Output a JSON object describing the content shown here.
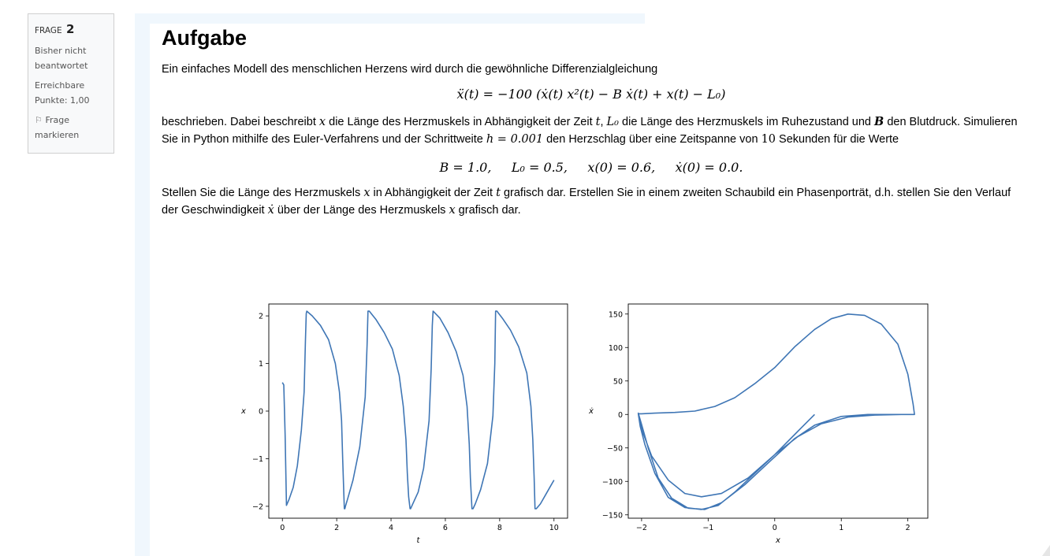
{
  "info": {
    "frage_label": "FRAGE",
    "frage_number": "2",
    "status": "Bisher nicht beantwortet",
    "points_label": "Erreichbare Punkte: 1,00",
    "flag_label": "Frage markieren"
  },
  "task": {
    "title": "Aufgabe",
    "intro": "Ein einfaches Modell des menschlichen Herzens wird durch die gewöhnliche Differenzialgleichung",
    "equation": "ẍ(t) = −100 (ẋ(t) x²(t) − B ẋ(t) + x(t) − L₀)",
    "desc_1": "beschrieben. Dabei beschreibt",
    "var_x": "x",
    "desc_2": "die Länge des Herzmuskels in Abhängigkeit der Zeit",
    "var_t": "t",
    "comma": ",",
    "var_L0": "L₀",
    "desc_3": "die Länge des Herzmuskels im Ruhezustand und",
    "var_B": "B",
    "desc_4": "den Blutdruck. Simulieren Sie in Python mithilfe des Euler-Verfahrens und der Schrittweite",
    "step": "h = 0.001",
    "desc_5": "den Herzschlag über eine Zeitspanne von",
    "duration": "10",
    "desc_6": "Sekunden für die Werte",
    "params": "B = 1.0,     L₀ = 0.5,     x(0) = 0.6,     ẋ(0) = 0.0.",
    "ask_1": "Stellen Sie die Länge des Herzmuskels",
    "ask_2": "in Abhängigkeit der Zeit",
    "ask_3": "grafisch dar. Erstellen Sie in einem zweiten Schaubild ein Phasenporträt, d.h. stellen Sie den Verlauf der Geschwindigkeit",
    "var_xdot": "ẋ",
    "ask_4": "über der Länge des Herzmuskels",
    "ask_5": "grafisch dar."
  },
  "colors": {
    "line": "#3f76b5",
    "panel": "#f0f7fd"
  },
  "chart_data": [
    {
      "type": "line",
      "xlabel": "t",
      "ylabel": "x",
      "xlim": [
        -0.5,
        10.5
      ],
      "ylim": [
        -2.25,
        2.25
      ],
      "xticks": [
        "0",
        "2",
        "4",
        "6",
        "8",
        "10"
      ],
      "yticks": [
        "−2",
        "−1",
        "0",
        "1",
        "2"
      ],
      "series": [
        {
          "x": [
            0,
            0.05,
            0.1,
            0.15,
            0.25,
            0.4,
            0.55,
            0.7,
            0.8,
            0.85,
            0.88,
            0.9,
            1.1,
            1.4,
            1.7,
            1.95,
            2.1,
            2.18,
            2.22,
            2.26,
            2.28,
            2.3,
            2.32,
            2.4,
            2.6,
            2.85,
            3.05,
            3.12,
            3.15,
            3.2,
            3.45,
            3.75,
            4.05,
            4.3,
            4.45,
            4.55,
            4.6,
            4.65,
            4.7,
            4.72,
            4.8,
            5.0,
            5.2,
            5.4,
            5.48,
            5.52,
            5.55,
            5.8,
            6.1,
            6.4,
            6.65,
            6.8,
            6.88,
            6.92,
            6.98,
            7.02,
            7.1,
            7.3,
            7.55,
            7.75,
            7.82,
            7.85,
            7.9,
            8.1,
            8.4,
            8.7,
            9.0,
            9.15,
            9.22,
            9.27,
            9.3,
            9.35,
            9.5,
            9.7,
            9.9,
            10.0
          ],
          "y": [
            0.6,
            0.55,
            -0.5,
            -1.98,
            -1.85,
            -1.6,
            -1.15,
            -0.4,
            0.4,
            1.5,
            2.05,
            2.1,
            2.0,
            1.8,
            1.5,
            1.0,
            0.4,
            -0.2,
            -1.0,
            -1.7,
            -2.05,
            -2.05,
            -2.0,
            -1.85,
            -1.45,
            -0.75,
            0.3,
            1.4,
            2.1,
            2.1,
            1.92,
            1.65,
            1.3,
            0.75,
            0.1,
            -0.6,
            -1.3,
            -1.8,
            -2.05,
            -2.05,
            -1.95,
            -1.7,
            -1.2,
            -0.2,
            0.9,
            1.8,
            2.1,
            1.95,
            1.65,
            1.25,
            0.75,
            0.1,
            -0.7,
            -1.4,
            -2.05,
            -2.05,
            -1.95,
            -1.65,
            -1.1,
            -0.1,
            1.0,
            2.1,
            2.1,
            1.95,
            1.7,
            1.35,
            0.8,
            0.1,
            -0.6,
            -1.4,
            -2.05,
            -2.05,
            -1.95,
            -1.75,
            -1.55,
            -1.45
          ]
        }
      ]
    },
    {
      "type": "line",
      "xlabel": "x",
      "ylabel": "ẋ",
      "xlim": [
        -2.2,
        2.3
      ],
      "ylim": [
        -155,
        165
      ],
      "xticks": [
        "−2",
        "−1",
        "0",
        "1",
        "2"
      ],
      "yticks": [
        "−150",
        "−100",
        "−50",
        "0",
        "50",
        "100",
        "150"
      ],
      "series": [
        {
          "x": [
            0.6,
            0.35,
            0.0,
            -0.4,
            -0.8,
            -1.1,
            -1.35,
            -1.6,
            -1.85,
            -2.0,
            -2.05,
            -2.0,
            -1.9,
            -1.75,
            -1.55,
            -1.3,
            -1.05,
            -0.8,
            -0.45,
            -0.05,
            0.3,
            0.6,
            1.0,
            1.4,
            1.8,
            2.05,
            2.1,
            2.08,
            2.0,
            1.85,
            1.6,
            1.35,
            1.1,
            0.85,
            0.6,
            0.3,
            0.0,
            -0.3,
            -0.6,
            -0.9,
            -1.2,
            -1.5,
            -1.8,
            -2.0,
            -2.05,
            -2.02,
            -1.95,
            -1.8,
            -1.6,
            -1.35,
            -1.1,
            -0.85,
            -0.6,
            -0.3,
            0.0,
            0.35,
            0.7,
            1.1,
            1.5,
            1.9,
            2.1
          ],
          "y": [
            0,
            -25,
            -60,
            -95,
            -118,
            -123,
            -118,
            -98,
            -62,
            -22,
            2,
            -15,
            -50,
            -95,
            -125,
            -140,
            -142,
            -132,
            -105,
            -68,
            -36,
            -16,
            -3,
            0,
            0,
            0,
            0,
            15,
            60,
            105,
            135,
            148,
            150,
            143,
            127,
            101,
            70,
            46,
            25,
            12,
            5,
            3,
            2,
            1,
            1,
            -18,
            -45,
            -88,
            -124,
            -139,
            -142,
            -136,
            -116,
            -88,
            -60,
            -33,
            -14,
            -4,
            -1,
            0,
            0
          ]
        }
      ]
    }
  ]
}
